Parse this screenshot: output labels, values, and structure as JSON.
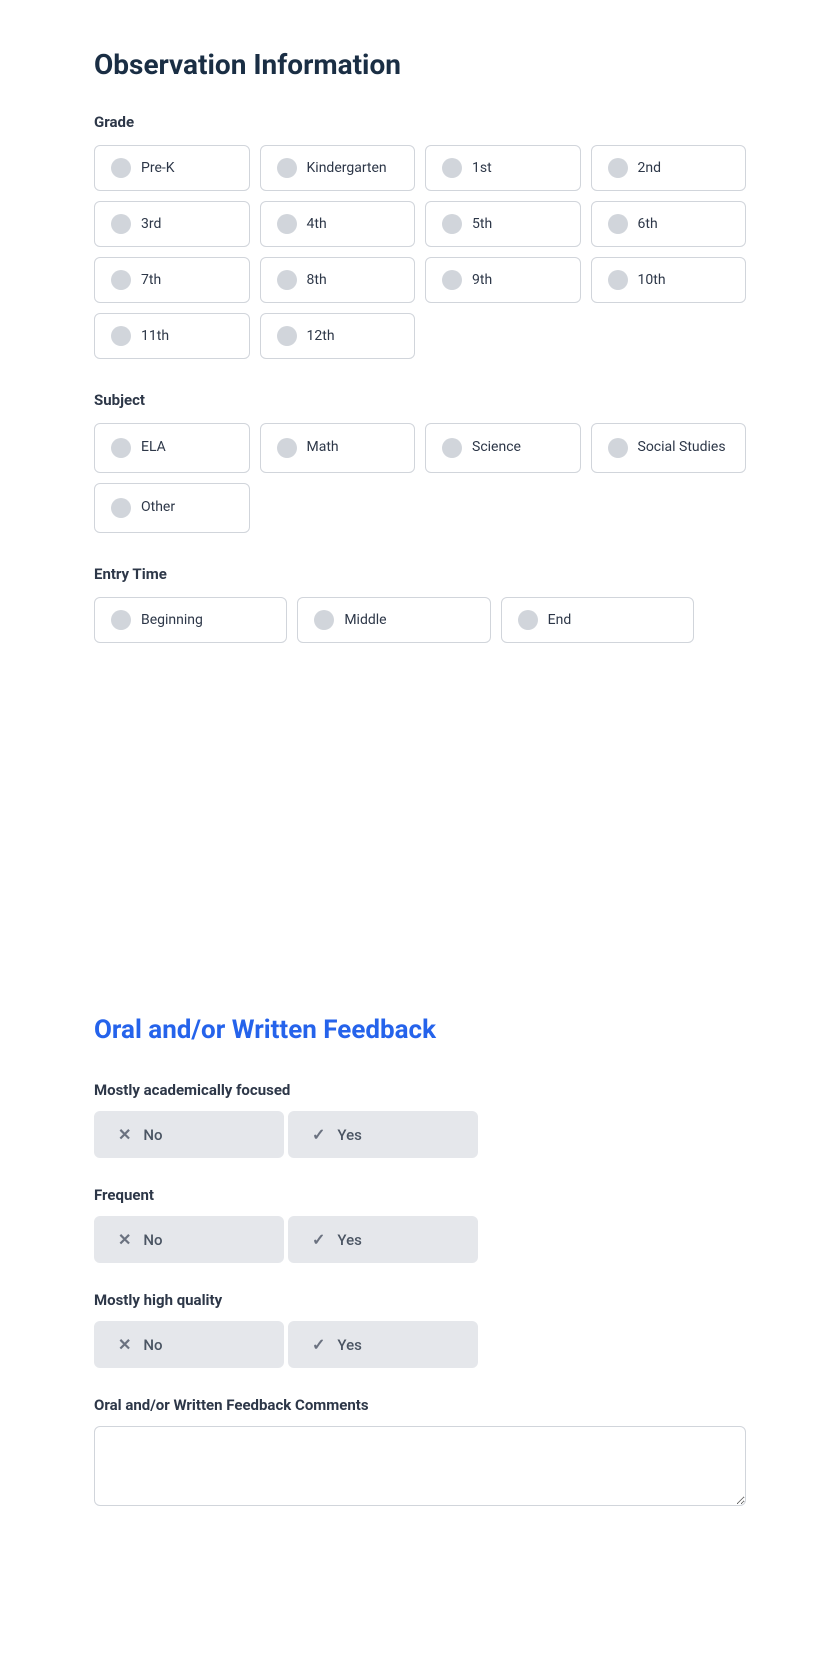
{
  "page": {
    "section1_title": "Observation Information",
    "grade_label": "Grade",
    "grade_options": [
      {
        "label": "Pre-K"
      },
      {
        "label": "Kindergarten"
      },
      {
        "label": "1st"
      },
      {
        "label": "2nd"
      },
      {
        "label": "3rd"
      },
      {
        "label": "4th"
      },
      {
        "label": "5th"
      },
      {
        "label": "6th"
      },
      {
        "label": "7th"
      },
      {
        "label": "8th"
      },
      {
        "label": "9th"
      },
      {
        "label": "10th"
      },
      {
        "label": "11th"
      },
      {
        "label": "12th"
      }
    ],
    "subject_label": "Subject",
    "subject_options": [
      {
        "label": "ELA"
      },
      {
        "label": "Math"
      },
      {
        "label": "Science"
      },
      {
        "label": "Social Studies"
      },
      {
        "label": "Other"
      }
    ],
    "entry_time_label": "Entry Time",
    "entry_time_options": [
      {
        "label": "Beginning"
      },
      {
        "label": "Middle"
      },
      {
        "label": "End"
      }
    ],
    "section2_title": "Oral and/or Written Feedback",
    "feedback_fields": [
      {
        "label": "Mostly academically focused",
        "no_label": "No",
        "yes_label": "Yes"
      },
      {
        "label": "Frequent",
        "no_label": "No",
        "yes_label": "Yes"
      },
      {
        "label": "Mostly high quality",
        "no_label": "No",
        "yes_label": "Yes"
      }
    ],
    "comments_label": "Oral and/or Written Feedback Comments",
    "comments_placeholder": ""
  }
}
